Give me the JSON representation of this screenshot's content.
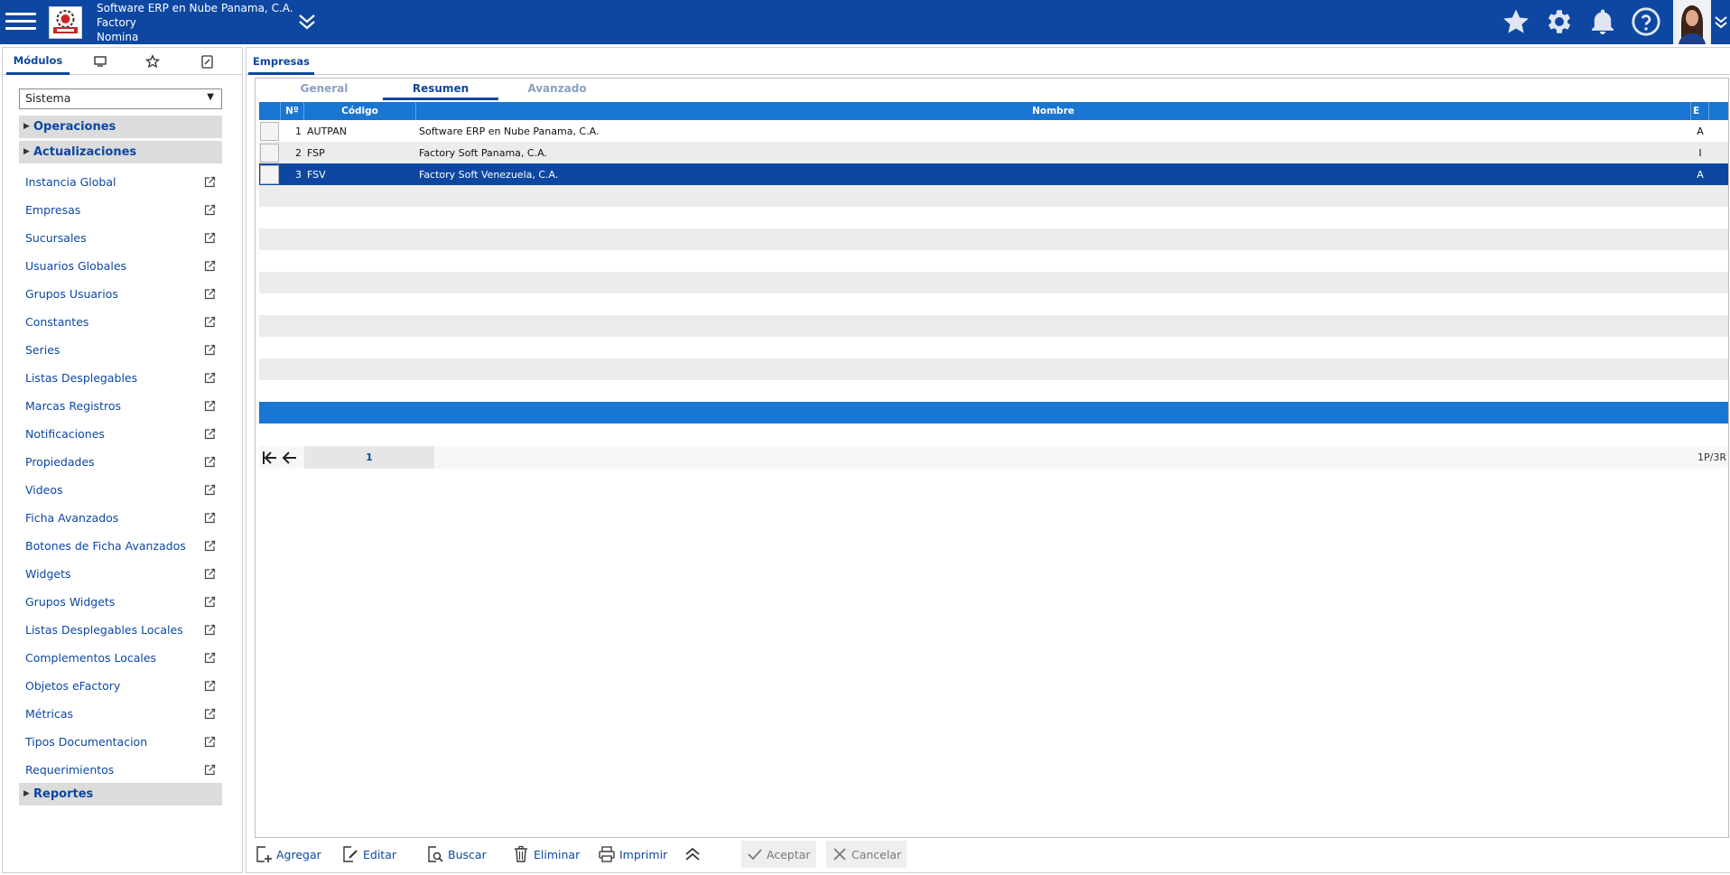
{
  "header": {
    "company": "Software ERP en Nube Panama, C.A.",
    "product": "Factory",
    "module": "Nomina"
  },
  "left_panel": {
    "tabs": [
      {
        "label": "Módulos",
        "icon": "modules-tab"
      },
      {
        "label": "",
        "icon": "monitor-icon"
      },
      {
        "label": "",
        "icon": "star-icon"
      },
      {
        "label": "",
        "icon": "edit-document-icon"
      }
    ],
    "module_select": "Sistema",
    "sections": {
      "operaciones": "Operaciones",
      "actualizaciones": "Actualizaciones",
      "reportes": "Reportes"
    },
    "items": [
      "Instancia Global",
      "Empresas",
      "Sucursales",
      "Usuarios Globales",
      "Grupos Usuarios",
      "Constantes",
      "Series",
      "Listas Desplegables",
      "Marcas Registros",
      "Notificaciones",
      "Propiedades",
      "Videos",
      "Ficha Avanzados",
      "Botones de Ficha Avanzados",
      "Widgets",
      "Grupos Widgets",
      "Listas Desplegables Locales",
      "Complementos Locales",
      "Objetos eFactory",
      "Métricas",
      "Tipos Documentacion",
      "Requerimientos"
    ]
  },
  "main": {
    "window_tab": "Empresas",
    "sub_tabs": [
      "General",
      "Resumen",
      "Avanzado"
    ],
    "active_sub_tab": "Resumen",
    "grid": {
      "columns": [
        "Nº",
        "Código",
        "Nombre",
        "E"
      ],
      "rows": [
        {
          "num": "1",
          "code": "AUTPAN",
          "name": "Software ERP en Nube Panama, C.A.",
          "e": "A"
        },
        {
          "num": "2",
          "code": "FSP",
          "name": "Factory Soft Panama, C.A.",
          "e": "I"
        },
        {
          "num": "3",
          "code": "FSV",
          "name": "Factory Soft Venezuela, C.A.",
          "e": "A"
        }
      ],
      "selected_row": 3
    },
    "pager": {
      "page": "1",
      "info": "1P/3R"
    },
    "toolbar": {
      "agregar": "Agregar",
      "editar": "Editar",
      "buscar": "Buscar",
      "eliminar": "Eliminar",
      "imprimir": "Imprimir",
      "aceptar": "Aceptar",
      "cancelar": "Cancelar"
    }
  },
  "colors": {
    "topbar": "#0d47a1",
    "grid_header": "#1976d2",
    "selected_row": "#0d47a1",
    "link_text": "#0d47a1"
  }
}
